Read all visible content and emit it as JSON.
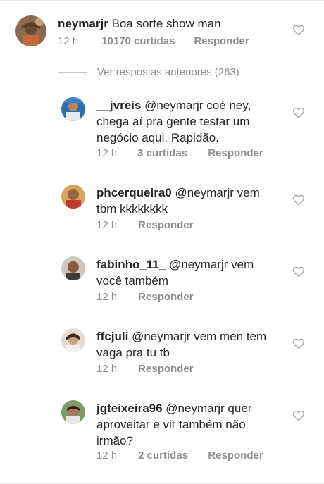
{
  "main_comment": {
    "username": "neymarjr",
    "text": "Boa sorte show man",
    "time": "12 h",
    "likes": "10170 curtidas",
    "reply": "Responder"
  },
  "view_previous": "Ver respostas anteriores (263)",
  "replies": [
    {
      "username": "__jvreis",
      "mention": "@neymarjr",
      "text": "coé ney, chega aí pra gente testar um negócio aqui. Rapidão.",
      "time": "12 h",
      "likes": "3 curtidas",
      "reply": "Responder"
    },
    {
      "username": "phcerqueira0",
      "mention": "@neymarjr",
      "text": "vem tbm kkkkkkkk",
      "time": "12 h",
      "likes": "",
      "reply": "Responder"
    },
    {
      "username": "fabinho_11_",
      "mention": "@neymarjr",
      "text": "vem você também",
      "time": "12 h",
      "likes": "",
      "reply": "Responder"
    },
    {
      "username": "ffcjuli",
      "mention": "@neymarjr",
      "text": "vem men tem vaga pra tu tb",
      "time": "12 h",
      "likes": "",
      "reply": "Responder"
    },
    {
      "username": "jgteixeira96",
      "mention": "@neymarjr",
      "text": "quer aproveitar e vir também não irmão?",
      "time": "12 h",
      "likes": "2 curtidas",
      "reply": "Responder"
    }
  ],
  "icons": {
    "like": "heart-outline-icon"
  },
  "colors": {
    "text": "#262626",
    "meta": "#8e8e8e",
    "heart": "#a8a8a8"
  }
}
